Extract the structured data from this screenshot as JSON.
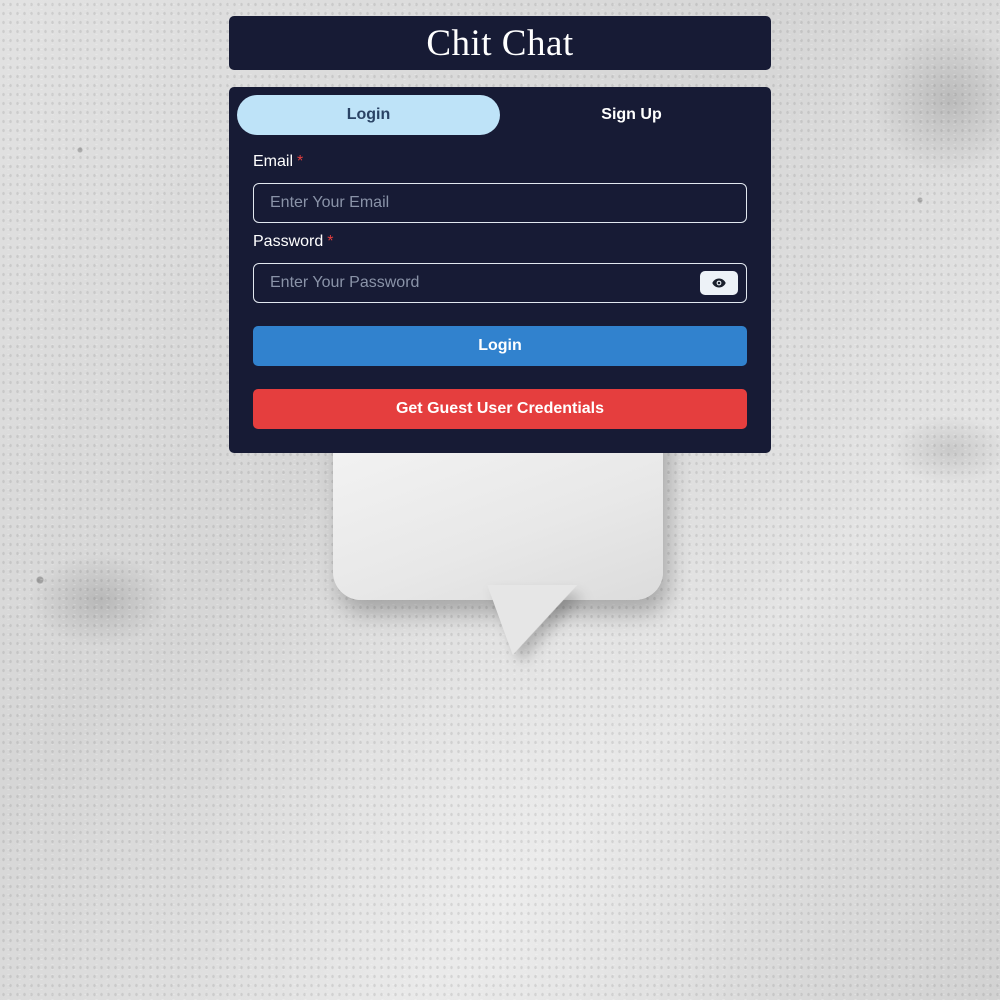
{
  "app": {
    "title": "Chit Chat"
  },
  "tabs": [
    {
      "label": "Login",
      "active": true
    },
    {
      "label": "Sign Up",
      "active": false
    }
  ],
  "form": {
    "email": {
      "label": "Email",
      "required_mark": "*",
      "value": "",
      "placeholder": "Enter Your Email"
    },
    "password": {
      "label": "Password",
      "required_mark": "*",
      "value": "",
      "placeholder": "Enter Your Password",
      "toggle_icon": "eye-icon"
    },
    "login_button": "Login",
    "guest_button": "Get Guest User Credentials"
  },
  "colors": {
    "panel": "#171b35",
    "active_tab_bg": "#bee3f8",
    "active_tab_text": "#2a4365",
    "login_button": "#3182ce",
    "guest_button": "#e53e3e",
    "required": "#e53e3e"
  }
}
